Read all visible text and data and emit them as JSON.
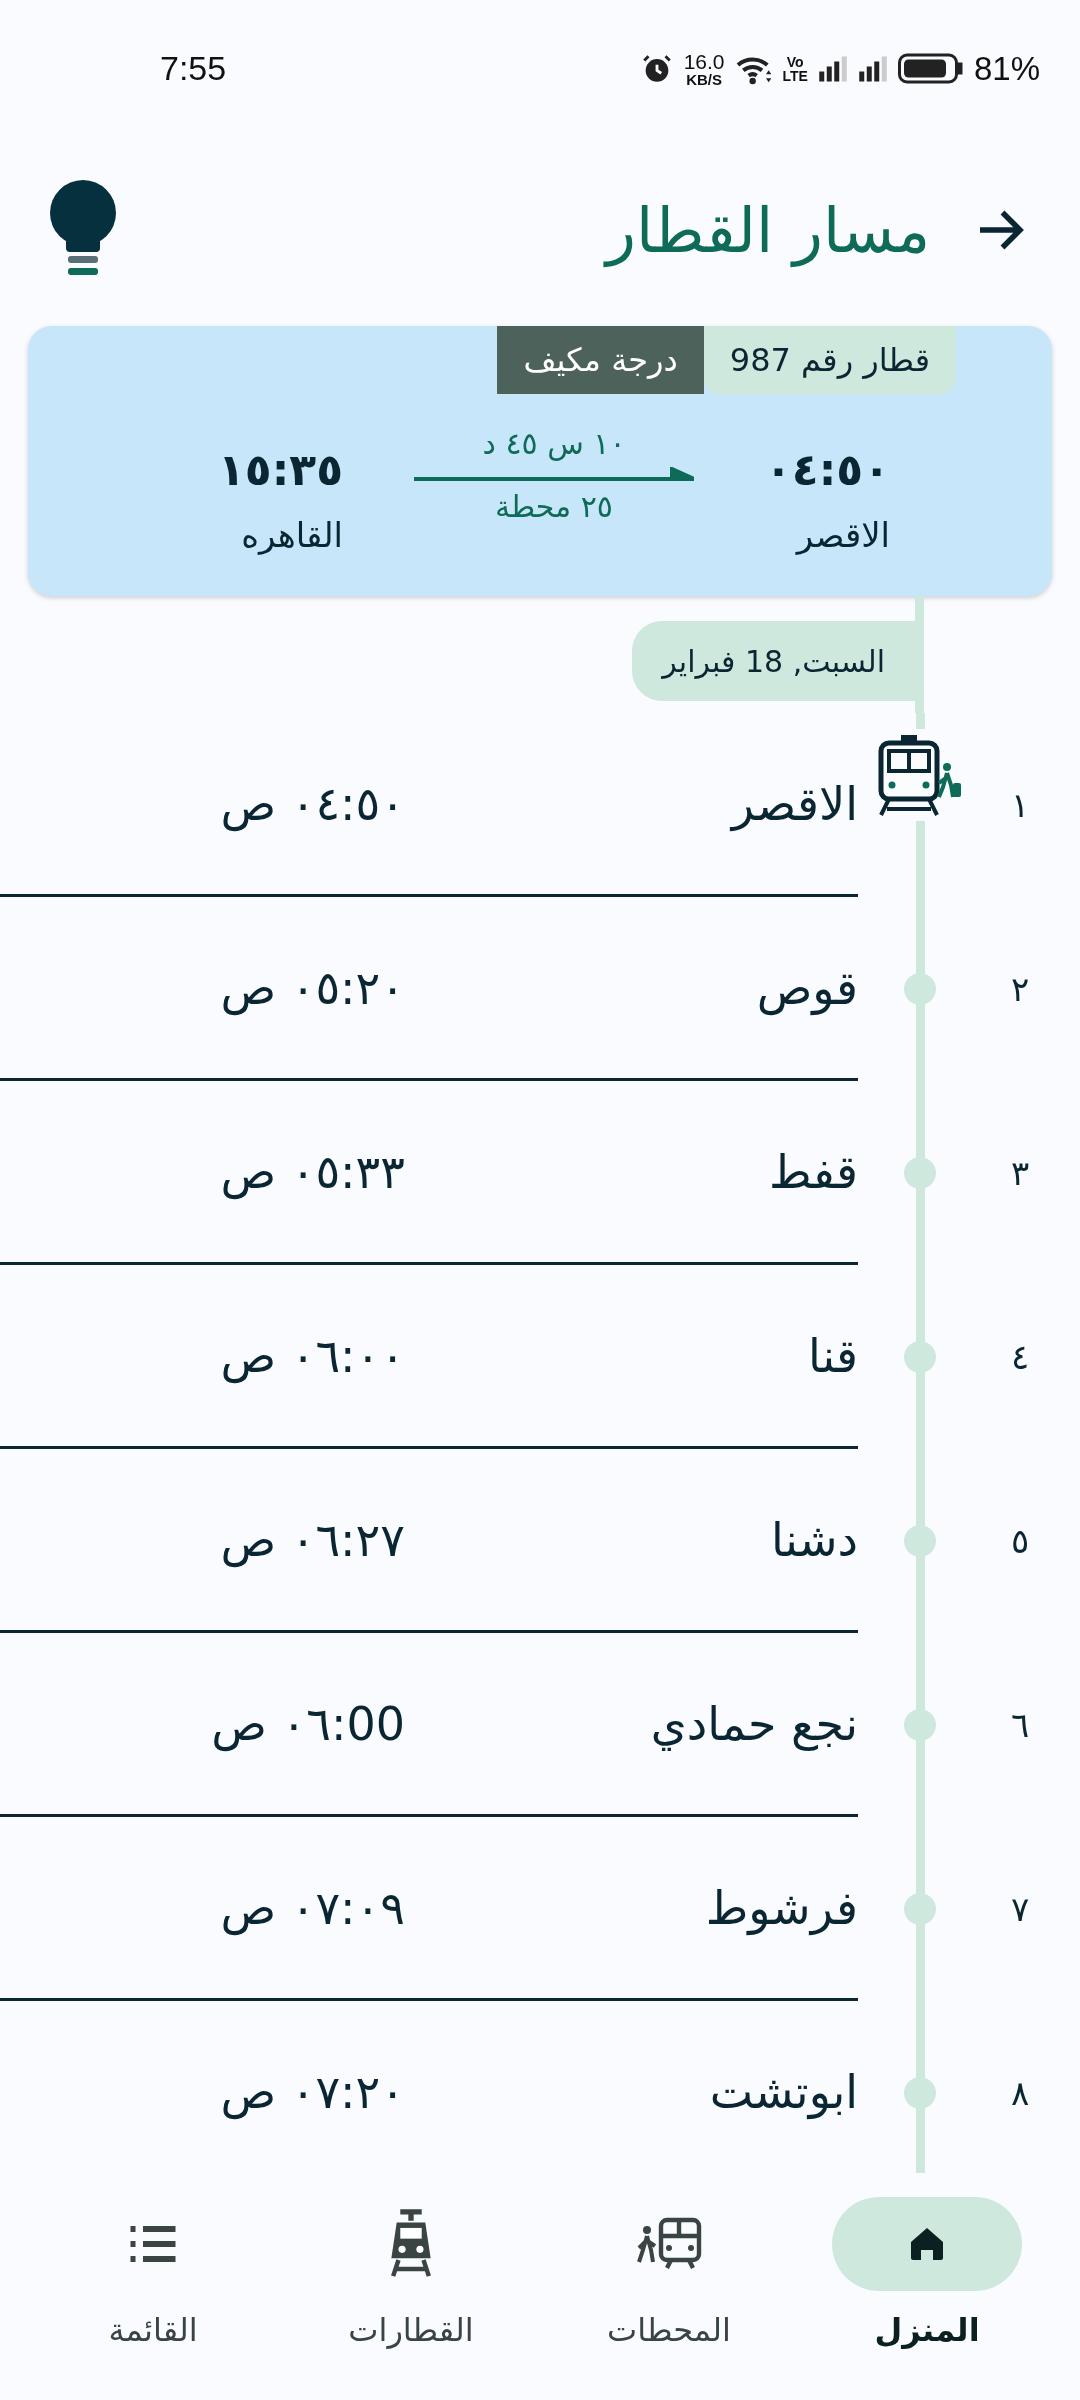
{
  "status_bar": {
    "time": "7:55",
    "speed": "16.0",
    "speed_unit": "KB/S",
    "volte_top": "Vo",
    "volte_bottom": "LTE",
    "battery": "81%"
  },
  "header": {
    "title": "مسار القطار"
  },
  "trip": {
    "train_number": "قطار رقم 987",
    "class": "درجة مكيف",
    "from_time": "٠٤:٥٠",
    "from_station": "الاقصر",
    "to_time": "١٥:٣٥",
    "to_station": "القاهره",
    "duration": "١٠ س ٤٥ د",
    "stops": "٢٥ محطة"
  },
  "date": "السبت, 18 فبراير",
  "stations": [
    {
      "number": "١",
      "name": "الاقصر",
      "time": "٠٤:٥٠ ص",
      "kind": "current"
    },
    {
      "number": "٢",
      "name": "قوص",
      "time": "٠٥:٢٠ ص",
      "kind": "stop"
    },
    {
      "number": "٣",
      "name": "قفط",
      "time": "٠٥:٣٣ ص",
      "kind": "stop"
    },
    {
      "number": "٤",
      "name": "قنا",
      "time": "٠٦:٠٠ ص",
      "kind": "stop"
    },
    {
      "number": "٥",
      "name": "دشنا",
      "time": "٠٦:٢٧ ص",
      "kind": "stop"
    },
    {
      "number": "٦",
      "name": "نجع حمادي",
      "time": "00:٠٦ ص",
      "kind": "stop"
    },
    {
      "number": "٧",
      "name": "فرشوط",
      "time": "٠٧:٠٩ ص",
      "kind": "stop"
    },
    {
      "number": "٨",
      "name": "ابوتشت",
      "time": "٠٧:٢٠ ص",
      "kind": "stop"
    }
  ],
  "nav": [
    {
      "label": "المنزل",
      "kind": "home",
      "selected": true
    },
    {
      "label": "المحطات",
      "kind": "stations",
      "selected": false
    },
    {
      "label": "القطارات",
      "kind": "trains",
      "selected": false
    },
    {
      "label": "القائمة",
      "kind": "list",
      "selected": false
    }
  ]
}
